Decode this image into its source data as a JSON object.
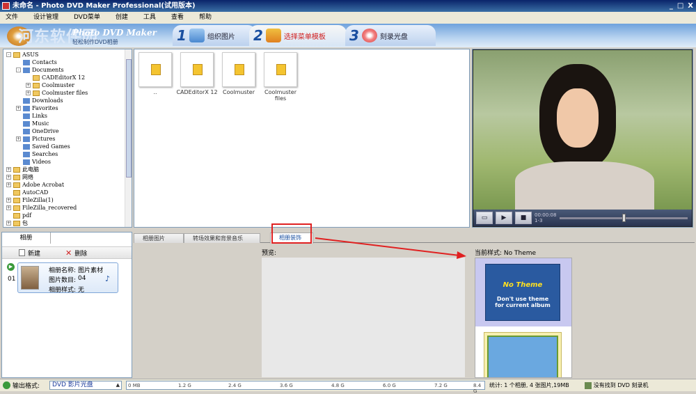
{
  "window": {
    "title": "未命名 - Photo DVD Maker Professional(试用版本)",
    "controls": [
      "_",
      "□",
      "X"
    ]
  },
  "menu": [
    "文件",
    "设计管理",
    "DVD菜单",
    "创建",
    "工具",
    "查看",
    "帮助"
  ],
  "banner": {
    "brand": "Photo DVD Maker",
    "brand_sub": "轻松制作DVD相册",
    "watermark": "河东软件园",
    "watermark_url": "www.pc0359.cn"
  },
  "steps": [
    {
      "num": "1",
      "label": "组织图片"
    },
    {
      "num": "2",
      "label": "选择菜单模板"
    },
    {
      "num": "3",
      "label": "刻录光盘"
    }
  ],
  "tree": [
    {
      "label": "ASUS",
      "level": 1,
      "expand": "-"
    },
    {
      "label": "Contacts",
      "level": 2,
      "expand": ""
    },
    {
      "label": "Documents",
      "level": 2,
      "expand": "-"
    },
    {
      "label": "CADEditorX 12",
      "level": 3,
      "expand": ""
    },
    {
      "label": "Coolmuster",
      "level": 3,
      "expand": "+"
    },
    {
      "label": "Coolmuster files",
      "level": 3,
      "expand": "+"
    },
    {
      "label": "Downloads",
      "level": 2,
      "expand": ""
    },
    {
      "label": "Favorites",
      "level": 2,
      "expand": "+"
    },
    {
      "label": "Links",
      "level": 2,
      "expand": ""
    },
    {
      "label": "Music",
      "level": 2,
      "expand": ""
    },
    {
      "label": "OneDrive",
      "level": 2,
      "expand": ""
    },
    {
      "label": "Pictures",
      "level": 2,
      "expand": "+"
    },
    {
      "label": "Saved Games",
      "level": 2,
      "expand": ""
    },
    {
      "label": "Searches",
      "level": 2,
      "expand": ""
    },
    {
      "label": "Videos",
      "level": 2,
      "expand": ""
    },
    {
      "label": "此电脑",
      "level": 1,
      "expand": "+"
    },
    {
      "label": "网络",
      "level": 1,
      "expand": "+"
    },
    {
      "label": "Adobe Acrobat",
      "level": 1,
      "expand": "+"
    },
    {
      "label": "AutoCAD",
      "level": 1,
      "expand": ""
    },
    {
      "label": "FileZilla(1)",
      "level": 1,
      "expand": "+"
    },
    {
      "label": "FileZilla_recovered",
      "level": 1,
      "expand": "+"
    },
    {
      "label": "pdf",
      "level": 1,
      "expand": ""
    },
    {
      "label": "包",
      "level": 1,
      "expand": "+"
    }
  ],
  "files": [
    "..",
    "CADEditorX 12",
    "Coolmuster",
    "Coolmuster files"
  ],
  "player": {
    "time": "00:00:08",
    "sub": "1-3"
  },
  "album_panel": {
    "tab": "相册",
    "new": "新建",
    "delete": "删除",
    "row_num": "01",
    "name_key": "相册名称:",
    "name_val": "图片素材",
    "count_key": "图片数目:",
    "count_val": "04",
    "style_key": "相册样式:",
    "style_val": "无"
  },
  "tabs": [
    "相册图片",
    "转场效果和背景音乐",
    "相册装饰"
  ],
  "decor": {
    "preview_label": "预览:",
    "current_style_label": "当前样式: No Theme",
    "theme_title": "No Theme",
    "theme_sub1": "Don't use theme",
    "theme_sub2": "for current album"
  },
  "status": {
    "output_label": "输出格式:",
    "output_value": "DVD 影片光盘",
    "ruler": [
      "0 MB",
      "1.2 G",
      "2.4 G",
      "3.6 G",
      "4.8 G",
      "6.0 G",
      "7.2 G",
      "8.4 G"
    ],
    "stats": "统计: 1 个相册, 4 张图片,19MB",
    "burner": "没有找到 DVD 刻录机"
  }
}
